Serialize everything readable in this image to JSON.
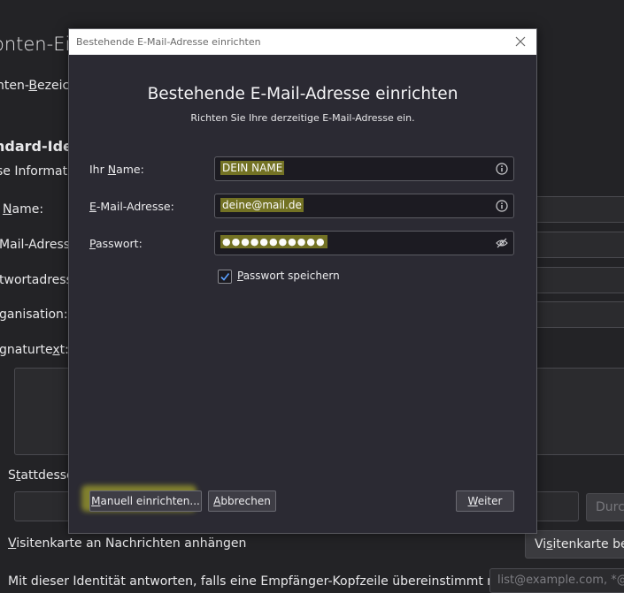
{
  "background": {
    "title": "onten-Ein",
    "account_name_label_pre": "nten-",
    "account_name_label_ul": "B",
    "account_name_label_post": "ezeic",
    "default_identity_heading": "ndard-Ide",
    "info_text": "se Informat",
    "name_label_ul": "N",
    "name_label_post": "ame:",
    "email_label": "Mail-Adresse",
    "reply_label": "twortadress",
    "org_label": "ganisation:",
    "signature_label_pre": "gnaturte",
    "signature_label_ul": "x",
    "signature_label_post": "t:",
    "instead_label_pre": "S",
    "instead_label_ul": "t",
    "instead_label_post": "attdesse",
    "browse_button": "Durch",
    "vcard_label_ul": "V",
    "vcard_label_post": "isitenkarte an Nachrichten anhängen",
    "vcard_button_pre": "Vi",
    "vcard_button_ul": "s",
    "vcard_button_post": "itenkarte bea",
    "reply_identity_text": "Mit dieser Identität antworten, falls eine Empfänger-Kopfzeile übereinstimmt mit:",
    "reply_identity_placeholder": "list@example.com, *@"
  },
  "dialog": {
    "window_title": "Bestehende E-Mail-Adresse einrichten",
    "heading": "Bestehende E-Mail-Adresse einrichten",
    "subheading": "Richten Sie Ihre derzeitige E-Mail-Adresse ein.",
    "name": {
      "label_pre": "Ihr ",
      "label_ul": "N",
      "label_post": "ame:",
      "value": "DEIN NAME",
      "icon": "info-icon"
    },
    "email": {
      "label_ul": "E",
      "label_post": "-Mail-Adresse:",
      "value": "deine@mail.de",
      "icon": "info-icon"
    },
    "password": {
      "label_ul": "P",
      "label_post": "asswort:",
      "value": "●●●●●●●●●●●",
      "icon": "eye-slash-icon"
    },
    "remember_password": {
      "label_ul": "P",
      "label_post": "asswort speichern",
      "checked": true
    },
    "buttons": {
      "manual_ul": "M",
      "manual_post": "anuell einrichten...",
      "cancel_ul": "A",
      "cancel_post": "bbrechen",
      "next_ul": "W",
      "next_post": "eiter"
    },
    "colors": {
      "highlight": "#ebeb28",
      "dialog_bg": "#2b2a33",
      "accent_check": "#5aa0ff"
    }
  }
}
